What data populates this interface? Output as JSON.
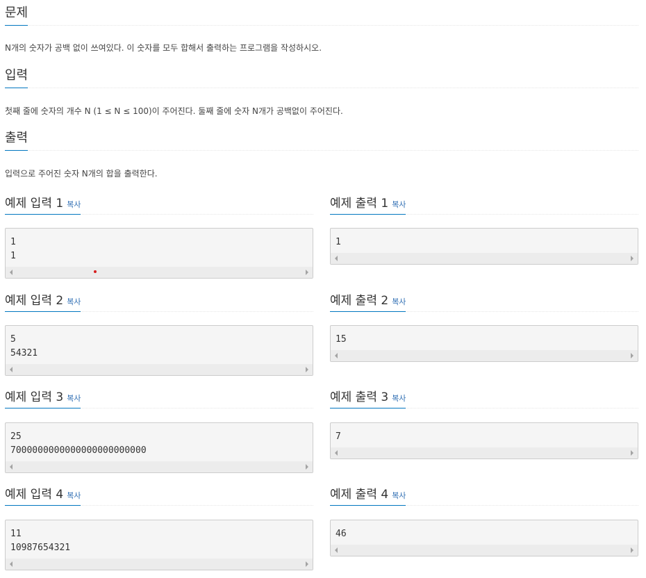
{
  "problem": {
    "title": "문제",
    "text": "N개의 숫자가 공백 없이 쓰여있다. 이 숫자를 모두 합해서 출력하는 프로그램을 작성하시오."
  },
  "input": {
    "title": "입력",
    "text": "첫째 줄에 숫자의 개수 N (1 ≤ N ≤ 100)이 주어진다. 둘째 줄에 숫자 N개가 공백없이 주어진다."
  },
  "output": {
    "title": "출력",
    "text": "입력으로 주어진 숫자 N개의 합을 출력한다."
  },
  "copy_label": "복사",
  "examples": [
    {
      "input_title": "예제 입력 1",
      "input_value": "1\n1",
      "output_title": "예제 출력 1",
      "output_value": "1"
    },
    {
      "input_title": "예제 입력 2",
      "input_value": "5\n54321",
      "output_title": "예제 출력 2",
      "output_value": "15"
    },
    {
      "input_title": "예제 입력 3",
      "input_value": "25\n7000000000000000000000000",
      "output_title": "예제 출력 3",
      "output_value": "7"
    },
    {
      "input_title": "예제 입력 4",
      "input_value": "11\n10987654321",
      "output_title": "예제 출력 4",
      "output_value": "46"
    }
  ]
}
